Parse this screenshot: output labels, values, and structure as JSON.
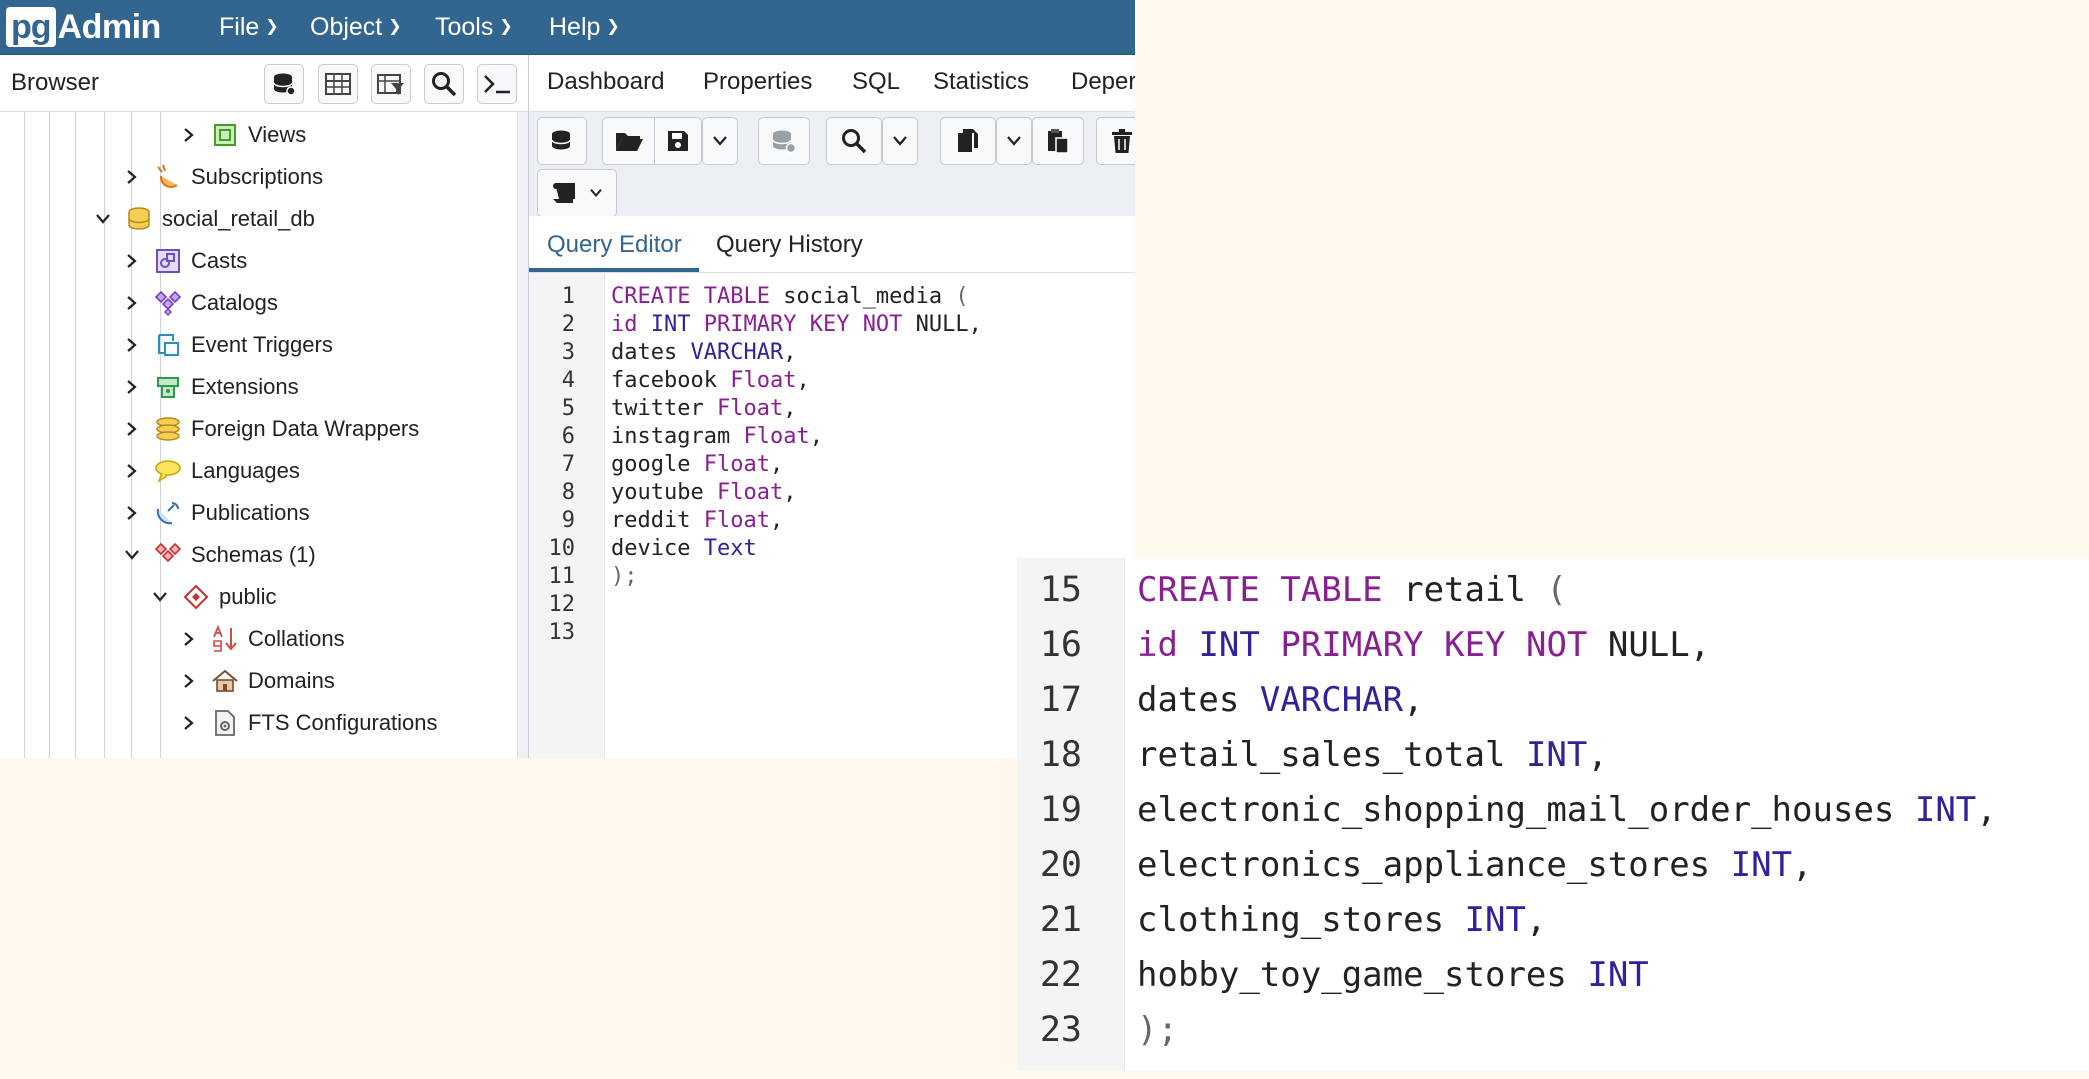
{
  "app": {
    "logo_pg": "pg",
    "logo_admin": "Admin"
  },
  "menu": [
    "File",
    "Object",
    "Tools",
    "Help"
  ],
  "browser": {
    "title": "Browser",
    "tree": [
      {
        "label": "Views",
        "expanded": false,
        "icon": "views-icon"
      },
      {
        "label": "Subscriptions",
        "expanded": false,
        "icon": "subscriptions-icon"
      },
      {
        "label": "social_retail_db",
        "expanded": true,
        "icon": "database-icon"
      },
      {
        "label": "Casts",
        "expanded": false,
        "icon": "casts-icon"
      },
      {
        "label": "Catalogs",
        "expanded": false,
        "icon": "catalogs-icon"
      },
      {
        "label": "Event Triggers",
        "expanded": false,
        "icon": "event-triggers-icon"
      },
      {
        "label": "Extensions",
        "expanded": false,
        "icon": "extensions-icon"
      },
      {
        "label": "Foreign Data Wrappers",
        "expanded": false,
        "icon": "foreign-data-wrappers-icon"
      },
      {
        "label": "Languages",
        "expanded": false,
        "icon": "languages-icon"
      },
      {
        "label": "Publications",
        "expanded": false,
        "icon": "publications-icon"
      },
      {
        "label": "Schemas (1)",
        "expanded": true,
        "icon": "schemas-icon"
      },
      {
        "label": "public",
        "expanded": true,
        "icon": "schema-icon"
      },
      {
        "label": "Collations",
        "expanded": false,
        "icon": "collations-icon"
      },
      {
        "label": "Domains",
        "expanded": false,
        "icon": "domains-icon"
      },
      {
        "label": "FTS Configurations",
        "expanded": false,
        "icon": "fts-configurations-icon"
      }
    ]
  },
  "tabs": [
    "Dashboard",
    "Properties",
    "SQL",
    "Statistics",
    "Deper"
  ],
  "query_tabs": [
    "Query Editor",
    "Query History"
  ],
  "editor": {
    "line_numbers": [
      "1",
      "2",
      "3",
      "4",
      "5",
      "6",
      "7",
      "8",
      "9",
      "10",
      "11",
      "12",
      "13"
    ],
    "lines": [
      [
        {
          "t": "CREATE TABLE",
          "c": "kw"
        },
        {
          "t": " social_media ",
          "c": ""
        },
        {
          "t": "(",
          "c": "dim"
        }
      ],
      [
        {
          "t": "id",
          "c": "kw"
        },
        {
          "t": " ",
          "c": ""
        },
        {
          "t": "INT",
          "c": "ty"
        },
        {
          "t": " ",
          "c": ""
        },
        {
          "t": "PRIMARY KEY NOT",
          "c": "kw"
        },
        {
          "t": " NULL,",
          "c": ""
        }
      ],
      [
        {
          "t": "dates ",
          "c": ""
        },
        {
          "t": "VARCHAR",
          "c": "ty"
        },
        {
          "t": ",",
          "c": ""
        }
      ],
      [
        {
          "t": "facebook ",
          "c": ""
        },
        {
          "t": "Float",
          "c": "kw"
        },
        {
          "t": ",",
          "c": ""
        }
      ],
      [
        {
          "t": "twitter ",
          "c": ""
        },
        {
          "t": "Float",
          "c": "kw"
        },
        {
          "t": ",",
          "c": ""
        }
      ],
      [
        {
          "t": "instagram ",
          "c": ""
        },
        {
          "t": "Float",
          "c": "kw"
        },
        {
          "t": ",",
          "c": ""
        }
      ],
      [
        {
          "t": "google ",
          "c": ""
        },
        {
          "t": "Float",
          "c": "kw"
        },
        {
          "t": ",",
          "c": ""
        }
      ],
      [
        {
          "t": "youtube ",
          "c": ""
        },
        {
          "t": "Float",
          "c": "kw"
        },
        {
          "t": ",",
          "c": ""
        }
      ],
      [
        {
          "t": "reddit ",
          "c": ""
        },
        {
          "t": "Float",
          "c": "kw"
        },
        {
          "t": ",",
          "c": ""
        }
      ],
      [
        {
          "t": "device ",
          "c": ""
        },
        {
          "t": "Text",
          "c": "ty"
        }
      ],
      [
        {
          "t": ");",
          "c": "dim"
        }
      ],
      [],
      []
    ]
  },
  "zoom": {
    "line_numbers": [
      "15",
      "16",
      "17",
      "18",
      "19",
      "20",
      "21",
      "22",
      "23"
    ],
    "lines": [
      [
        {
          "t": "CREATE TABLE",
          "c": "kw"
        },
        {
          "t": " retail ",
          "c": ""
        },
        {
          "t": "(",
          "c": "dim"
        }
      ],
      [
        {
          "t": "id",
          "c": "kw"
        },
        {
          "t": " ",
          "c": ""
        },
        {
          "t": "INT",
          "c": "ty"
        },
        {
          "t": " ",
          "c": ""
        },
        {
          "t": "PRIMARY KEY NOT",
          "c": "kw"
        },
        {
          "t": " NULL,",
          "c": ""
        }
      ],
      [
        {
          "t": "dates ",
          "c": ""
        },
        {
          "t": "VARCHAR",
          "c": "ty"
        },
        {
          "t": ",",
          "c": ""
        }
      ],
      [
        {
          "t": "retail_sales_total ",
          "c": ""
        },
        {
          "t": "INT",
          "c": "ty"
        },
        {
          "t": ",",
          "c": ""
        }
      ],
      [
        {
          "t": "electronic_shopping_mail_order_houses ",
          "c": ""
        },
        {
          "t": "INT",
          "c": "ty"
        },
        {
          "t": ",",
          "c": ""
        }
      ],
      [
        {
          "t": "electronics_appliance_stores ",
          "c": ""
        },
        {
          "t": "INT",
          "c": "ty"
        },
        {
          "t": ",",
          "c": ""
        }
      ],
      [
        {
          "t": "clothing_stores ",
          "c": ""
        },
        {
          "t": "INT",
          "c": "ty"
        },
        {
          "t": ",",
          "c": ""
        }
      ],
      [
        {
          "t": "hobby_toy_game_stores ",
          "c": ""
        },
        {
          "t": "INT",
          "c": "ty"
        }
      ],
      [
        {
          "t": ");",
          "c": "dim"
        }
      ]
    ]
  },
  "colors": {
    "header_blue": "#326690",
    "keyword": "#8a1e93",
    "type": "#30229b"
  }
}
